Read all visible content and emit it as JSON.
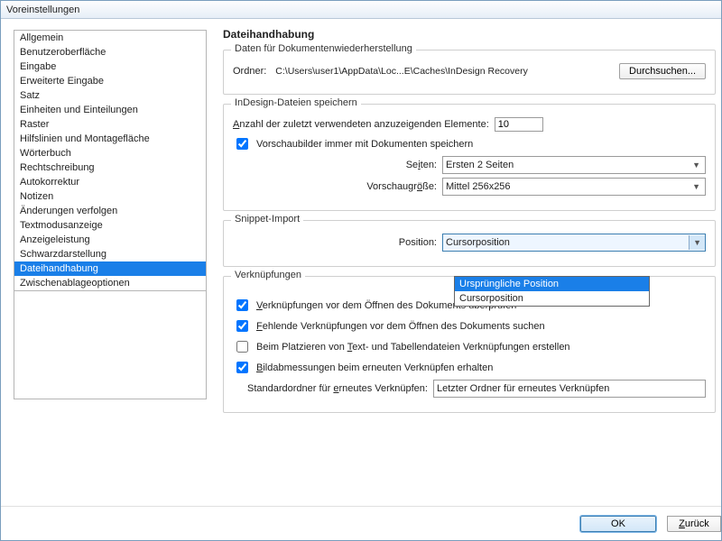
{
  "window": {
    "title": "Voreinstellungen"
  },
  "sidebar": {
    "items": [
      "Allgemein",
      "Benutzeroberfläche",
      "Eingabe",
      "Erweiterte Eingabe",
      "Satz",
      "Einheiten und Einteilungen",
      "Raster",
      "Hilfslinien und Montagefläche",
      "Wörterbuch",
      "Rechtschreibung",
      "Autokorrektur",
      "Notizen",
      "Änderungen verfolgen",
      "Textmodusanzeige",
      "Anzeigeleistung",
      "Schwarzdarstellung",
      "Dateihandhabung",
      "Zwischenablageoptionen"
    ],
    "selected_index": 16
  },
  "panel": {
    "title": "Dateihandhabung",
    "recovery": {
      "legend": "Daten für Dokumentenwiederherstellung",
      "folder_label": "Ordner:",
      "folder_value": "C:\\Users\\user1\\AppData\\Loc...E\\Caches\\InDesign Recovery",
      "browse_btn": "Durchsuchen..."
    },
    "saving": {
      "legend": "InDesign-Dateien speichern",
      "recent_label_pre": "A",
      "recent_label_rest": "nzahl der zuletzt verwendeten anzuzeigenden Elemente:",
      "recent_value": "10",
      "preview_checkbox": "Vorschaubilder immer mit Dokumenten speichern",
      "pages_label_pre": "Se",
      "pages_label_u": "i",
      "pages_label_post": "ten:",
      "pages_value": "Ersten 2 Seiten",
      "size_label_pre": "Vorschaugr",
      "size_label_u": "ö",
      "size_label_post": "ße:",
      "size_value": "Mittel 256x256"
    },
    "snippet": {
      "legend": "Snippet-Import",
      "position_label": "Position:",
      "selected": "Cursorposition",
      "options": [
        "Ursprüngliche Position",
        "Cursorposition"
      ],
      "highlight_index": 0
    },
    "links": {
      "legend": "Verknüpfungen",
      "c1_pre": "V",
      "c1_rest": "erknüpfungen vor dem Öffnen des Dokuments überprüfen",
      "c2_pre": "F",
      "c2_rest": "ehlende Verknüpfungen vor dem Öffnen des Dokuments suchen",
      "c3_pre": "Beim Platzieren von ",
      "c3_u": "T",
      "c3_rest": "ext- und Tabellendateien Verknüpfungen erstellen",
      "c4_pre": "B",
      "c4_rest": "ildabmessungen beim erneuten Verknüpfen erhalten",
      "relink_label_pre": "Standardordner für ",
      "relink_label_u": "e",
      "relink_label_post": "rneutes Verknüpfen:",
      "relink_value": "Letzter Ordner für erneutes Verknüpfen"
    }
  },
  "footer": {
    "ok": "OK",
    "reset_pre": "Z",
    "reset_rest": "urück"
  }
}
